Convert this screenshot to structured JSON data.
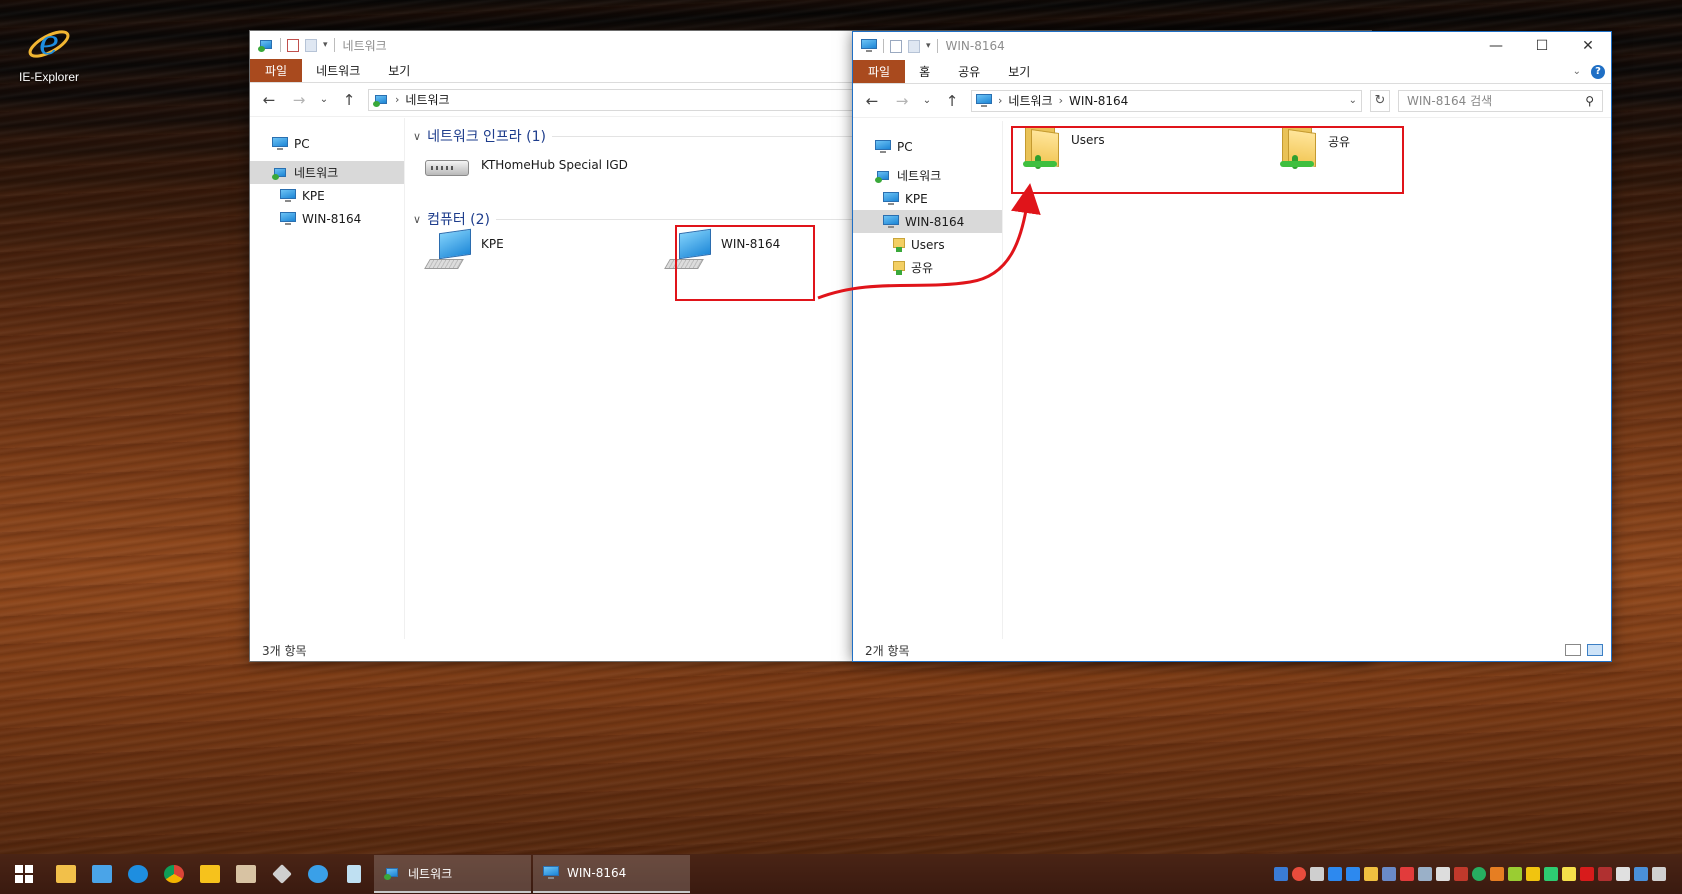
{
  "desktop": {
    "ie_label": "IE-Explorer"
  },
  "left_window": {
    "title": "네트워크",
    "tabs": {
      "file": "파일",
      "network": "네트워크",
      "view": "보기"
    },
    "address": "네트워크",
    "sidebar": {
      "pc": "PC",
      "network": "네트워크",
      "kpe": "KPE",
      "win": "WIN-8164"
    },
    "groups": {
      "infra": "네트워크 인프라 (1)",
      "computers": "컴퓨터 (2)"
    },
    "items": {
      "router": "KTHomeHub Special IGD",
      "kpe": "KPE",
      "win": "WIN-8164"
    },
    "status": "3개 항목"
  },
  "right_window": {
    "title": "WIN-8164",
    "tabs": {
      "file": "파일",
      "home": "홈",
      "share": "공유",
      "view": "보기"
    },
    "address": {
      "network": "네트워크",
      "win": "WIN-8164"
    },
    "search_placeholder": "WIN-8164 검색",
    "sidebar": {
      "pc": "PC",
      "network": "네트워크",
      "kpe": "KPE",
      "win": "WIN-8164",
      "users": "Users",
      "share": "공유"
    },
    "items": {
      "users": "Users",
      "share": "공유"
    },
    "status": "2개 항목"
  },
  "taskbar": {
    "tasks": {
      "network": "네트워크",
      "win": "WIN-8164"
    }
  },
  "colors": {
    "highlight": "#e0141a",
    "file_tab": "#a94a1e",
    "accent": "#1f6fc5"
  }
}
